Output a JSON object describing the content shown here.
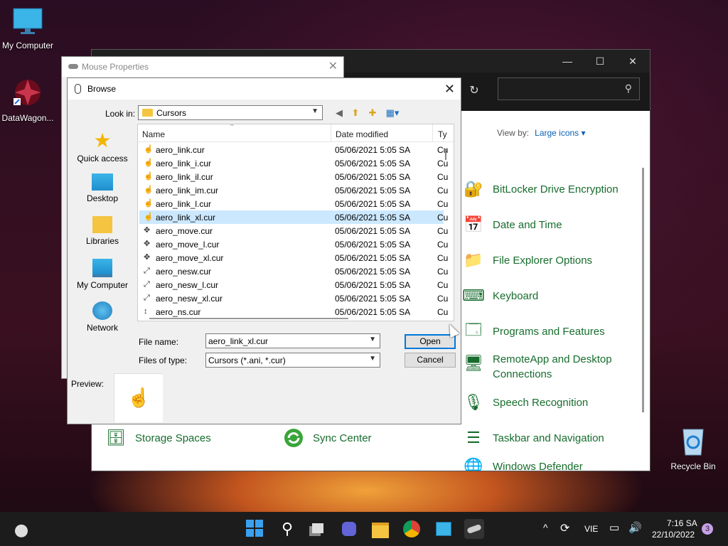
{
  "desktop": {
    "my_computer": "My Computer",
    "datawagon": "DataWagon...",
    "recycle_bin": "Recycle Bin"
  },
  "control_panel": {
    "view_by_label": "View by:",
    "view_by_value": "Large icons",
    "items": [
      "BitLocker Drive Encryption",
      "Date and Time",
      "File Explorer Options",
      "Keyboard",
      "Programs and Features",
      "RemoteApp and Desktop Connections",
      "Speech Recognition",
      "Taskbar and Navigation",
      "Windows Defender",
      "Storage Spaces",
      "Sync Center"
    ]
  },
  "mouse_properties": {
    "title": "Mouse Properties"
  },
  "browse": {
    "title": "Browse",
    "look_in_label": "Look in:",
    "look_in_value": "Cursors",
    "places": [
      "Quick access",
      "Desktop",
      "Libraries",
      "My Computer",
      "Network"
    ],
    "columns": {
      "name": "Name",
      "date": "Date modified",
      "type": "Ty"
    },
    "files": [
      {
        "name": "aero_link.cur",
        "date": "05/06/2021 5:05 SA",
        "type": "Cu"
      },
      {
        "name": "aero_link_i.cur",
        "date": "05/06/2021 5:05 SA",
        "type": "Cu"
      },
      {
        "name": "aero_link_il.cur",
        "date": "05/06/2021 5:05 SA",
        "type": "Cu"
      },
      {
        "name": "aero_link_im.cur",
        "date": "05/06/2021 5:05 SA",
        "type": "Cu"
      },
      {
        "name": "aero_link_l.cur",
        "date": "05/06/2021 5:05 SA",
        "type": "Cu"
      },
      {
        "name": "aero_link_xl.cur",
        "date": "05/06/2021 5:05 SA",
        "type": "Cu"
      },
      {
        "name": "aero_move.cur",
        "date": "05/06/2021 5:05 SA",
        "type": "Cu"
      },
      {
        "name": "aero_move_l.cur",
        "date": "05/06/2021 5:05 SA",
        "type": "Cu"
      },
      {
        "name": "aero_move_xl.cur",
        "date": "05/06/2021 5:05 SA",
        "type": "Cu"
      },
      {
        "name": "aero_nesw.cur",
        "date": "05/06/2021 5:05 SA",
        "type": "Cu"
      },
      {
        "name": "aero_nesw_l.cur",
        "date": "05/06/2021 5:05 SA",
        "type": "Cu"
      },
      {
        "name": "aero_nesw_xl.cur",
        "date": "05/06/2021 5:05 SA",
        "type": "Cu"
      },
      {
        "name": "aero_ns.cur",
        "date": "05/06/2021 5:05 SA",
        "type": "Cu"
      }
    ],
    "selected_index": 5,
    "file_name_label": "File name:",
    "file_name_value": "aero_link_xl.cur",
    "files_of_type_label": "Files of type:",
    "files_of_type_value": "Cursors (*.ani, *.cur)",
    "open_label": "Open",
    "cancel_label": "Cancel",
    "preview_label": "Preview:"
  },
  "taskbar": {
    "language": "VIE",
    "time": "7:16 SA",
    "date": "22/10/2022",
    "notification_count": "3"
  },
  "colors": {
    "cp_link": "#176d2d",
    "selection": "#cce8ff",
    "accent": "#0078d7"
  }
}
